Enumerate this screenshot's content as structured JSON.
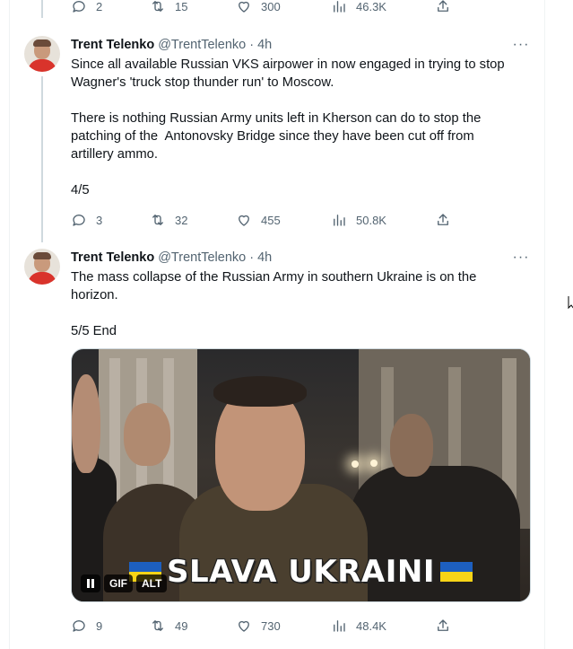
{
  "top_actions": {
    "reply": "2",
    "retweet": "15",
    "like": "300",
    "views": "46.3K"
  },
  "tweets": [
    {
      "name": "Trent Telenko",
      "handle": "@TrentTelenko",
      "time": "· 4h",
      "text": "Since all available Russian VKS airpower in now engaged in trying to stop\nWagner's 'truck stop thunder run' to Moscow.\n\nThere is nothing Russian Army units left in Kherson can do to stop the\npatching of the  Antonovsky Bridge since they have been cut off from\nartillery ammo.\n\n4/5",
      "actions": {
        "reply": "3",
        "retweet": "32",
        "like": "455",
        "views": "50.8K"
      }
    },
    {
      "name": "Trent Telenko",
      "handle": "@TrentTelenko",
      "time": "· 4h",
      "text": "The mass collapse of the Russian Army in southern Ukraine is on the\nhorizon.\n\n5/5 End",
      "media": {
        "caption": "SLAVA UKRAINI",
        "badge_gif": "GIF",
        "badge_alt": "ALT"
      },
      "actions": {
        "reply": "9",
        "retweet": "49",
        "like": "730",
        "views": "48.4K"
      }
    }
  ],
  "more_icon": "···"
}
